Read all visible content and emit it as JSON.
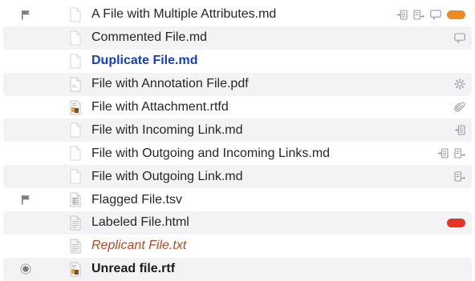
{
  "colors": {
    "label_orange": "#f08a1c",
    "label_red": "#e83223",
    "duplicate_text": "#1540c6",
    "replicant_text": "#c0461a",
    "icon_gray": "#9a9aa0"
  },
  "files": [
    {
      "name": "A File with Multiple Attributes.md",
      "flagged": true,
      "unread": false,
      "file_icon": "markdown-document-icon",
      "attributes": [
        "incoming-links-icon",
        "outgoing-links-icon",
        "comment-icon",
        "label-orange"
      ]
    },
    {
      "name": "Commented File.md",
      "flagged": false,
      "unread": false,
      "file_icon": "markdown-document-icon",
      "attributes": [
        "comment-icon"
      ]
    },
    {
      "name": "Duplicate File.md",
      "flagged": false,
      "unread": false,
      "file_icon": "markdown-document-icon",
      "style": "duplicate",
      "attributes": []
    },
    {
      "name": "File with Annotation File.pdf",
      "flagged": false,
      "unread": false,
      "file_icon": "pdf-document-icon",
      "attributes": [
        "annotation-icon"
      ]
    },
    {
      "name": "File with Attachment.rtfd",
      "flagged": false,
      "unread": false,
      "file_icon": "rtfd-document-icon",
      "attributes": [
        "attachment-icon"
      ]
    },
    {
      "name": "File with Incoming Link.md",
      "flagged": false,
      "unread": false,
      "file_icon": "markdown-document-icon",
      "attributes": [
        "incoming-links-icon"
      ]
    },
    {
      "name": "File with Outgoing and Incoming Links.md",
      "flagged": false,
      "unread": false,
      "file_icon": "markdown-document-icon",
      "attributes": [
        "incoming-links-icon",
        "outgoing-links-icon"
      ]
    },
    {
      "name": "File with Outgoing Link.md",
      "flagged": false,
      "unread": false,
      "file_icon": "markdown-document-icon",
      "attributes": [
        "outgoing-links-icon"
      ]
    },
    {
      "name": "Flagged File.tsv",
      "flagged": true,
      "unread": false,
      "file_icon": "tsv-document-icon",
      "attributes": []
    },
    {
      "name": "Labeled File.html",
      "flagged": false,
      "unread": false,
      "file_icon": "html-document-icon",
      "attributes": [
        "label-red"
      ]
    },
    {
      "name": "Replicant File.txt",
      "flagged": false,
      "unread": false,
      "file_icon": "text-document-icon",
      "style": "replicant",
      "attributes": []
    },
    {
      "name": "Unread file.rtf",
      "flagged": false,
      "unread": true,
      "file_icon": "rtf-document-icon",
      "style": "unread",
      "attributes": []
    }
  ]
}
